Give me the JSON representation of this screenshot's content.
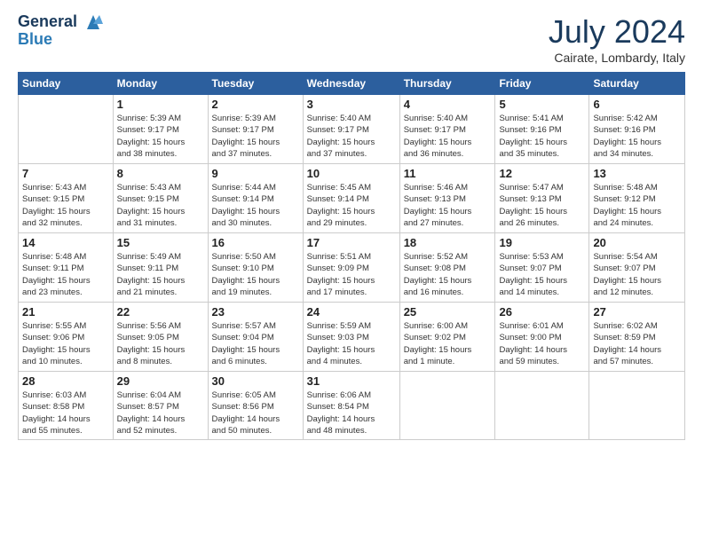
{
  "header": {
    "logo_line1": "General",
    "logo_line2": "Blue",
    "month_year": "July 2024",
    "location": "Cairate, Lombardy, Italy"
  },
  "columns": [
    "Sunday",
    "Monday",
    "Tuesday",
    "Wednesday",
    "Thursday",
    "Friday",
    "Saturday"
  ],
  "weeks": [
    [
      {
        "day": "",
        "info": ""
      },
      {
        "day": "1",
        "info": "Sunrise: 5:39 AM\nSunset: 9:17 PM\nDaylight: 15 hours\nand 38 minutes."
      },
      {
        "day": "2",
        "info": "Sunrise: 5:39 AM\nSunset: 9:17 PM\nDaylight: 15 hours\nand 37 minutes."
      },
      {
        "day": "3",
        "info": "Sunrise: 5:40 AM\nSunset: 9:17 PM\nDaylight: 15 hours\nand 37 minutes."
      },
      {
        "day": "4",
        "info": "Sunrise: 5:40 AM\nSunset: 9:17 PM\nDaylight: 15 hours\nand 36 minutes."
      },
      {
        "day": "5",
        "info": "Sunrise: 5:41 AM\nSunset: 9:16 PM\nDaylight: 15 hours\nand 35 minutes."
      },
      {
        "day": "6",
        "info": "Sunrise: 5:42 AM\nSunset: 9:16 PM\nDaylight: 15 hours\nand 34 minutes."
      }
    ],
    [
      {
        "day": "7",
        "info": "Sunrise: 5:43 AM\nSunset: 9:15 PM\nDaylight: 15 hours\nand 32 minutes."
      },
      {
        "day": "8",
        "info": "Sunrise: 5:43 AM\nSunset: 9:15 PM\nDaylight: 15 hours\nand 31 minutes."
      },
      {
        "day": "9",
        "info": "Sunrise: 5:44 AM\nSunset: 9:14 PM\nDaylight: 15 hours\nand 30 minutes."
      },
      {
        "day": "10",
        "info": "Sunrise: 5:45 AM\nSunset: 9:14 PM\nDaylight: 15 hours\nand 29 minutes."
      },
      {
        "day": "11",
        "info": "Sunrise: 5:46 AM\nSunset: 9:13 PM\nDaylight: 15 hours\nand 27 minutes."
      },
      {
        "day": "12",
        "info": "Sunrise: 5:47 AM\nSunset: 9:13 PM\nDaylight: 15 hours\nand 26 minutes."
      },
      {
        "day": "13",
        "info": "Sunrise: 5:48 AM\nSunset: 9:12 PM\nDaylight: 15 hours\nand 24 minutes."
      }
    ],
    [
      {
        "day": "14",
        "info": "Sunrise: 5:48 AM\nSunset: 9:11 PM\nDaylight: 15 hours\nand 23 minutes."
      },
      {
        "day": "15",
        "info": "Sunrise: 5:49 AM\nSunset: 9:11 PM\nDaylight: 15 hours\nand 21 minutes."
      },
      {
        "day": "16",
        "info": "Sunrise: 5:50 AM\nSunset: 9:10 PM\nDaylight: 15 hours\nand 19 minutes."
      },
      {
        "day": "17",
        "info": "Sunrise: 5:51 AM\nSunset: 9:09 PM\nDaylight: 15 hours\nand 17 minutes."
      },
      {
        "day": "18",
        "info": "Sunrise: 5:52 AM\nSunset: 9:08 PM\nDaylight: 15 hours\nand 16 minutes."
      },
      {
        "day": "19",
        "info": "Sunrise: 5:53 AM\nSunset: 9:07 PM\nDaylight: 15 hours\nand 14 minutes."
      },
      {
        "day": "20",
        "info": "Sunrise: 5:54 AM\nSunset: 9:07 PM\nDaylight: 15 hours\nand 12 minutes."
      }
    ],
    [
      {
        "day": "21",
        "info": "Sunrise: 5:55 AM\nSunset: 9:06 PM\nDaylight: 15 hours\nand 10 minutes."
      },
      {
        "day": "22",
        "info": "Sunrise: 5:56 AM\nSunset: 9:05 PM\nDaylight: 15 hours\nand 8 minutes."
      },
      {
        "day": "23",
        "info": "Sunrise: 5:57 AM\nSunset: 9:04 PM\nDaylight: 15 hours\nand 6 minutes."
      },
      {
        "day": "24",
        "info": "Sunrise: 5:59 AM\nSunset: 9:03 PM\nDaylight: 15 hours\nand 4 minutes."
      },
      {
        "day": "25",
        "info": "Sunrise: 6:00 AM\nSunset: 9:02 PM\nDaylight: 15 hours\nand 1 minute."
      },
      {
        "day": "26",
        "info": "Sunrise: 6:01 AM\nSunset: 9:00 PM\nDaylight: 14 hours\nand 59 minutes."
      },
      {
        "day": "27",
        "info": "Sunrise: 6:02 AM\nSunset: 8:59 PM\nDaylight: 14 hours\nand 57 minutes."
      }
    ],
    [
      {
        "day": "28",
        "info": "Sunrise: 6:03 AM\nSunset: 8:58 PM\nDaylight: 14 hours\nand 55 minutes."
      },
      {
        "day": "29",
        "info": "Sunrise: 6:04 AM\nSunset: 8:57 PM\nDaylight: 14 hours\nand 52 minutes."
      },
      {
        "day": "30",
        "info": "Sunrise: 6:05 AM\nSunset: 8:56 PM\nDaylight: 14 hours\nand 50 minutes."
      },
      {
        "day": "31",
        "info": "Sunrise: 6:06 AM\nSunset: 8:54 PM\nDaylight: 14 hours\nand 48 minutes."
      },
      {
        "day": "",
        "info": ""
      },
      {
        "day": "",
        "info": ""
      },
      {
        "day": "",
        "info": ""
      }
    ]
  ]
}
